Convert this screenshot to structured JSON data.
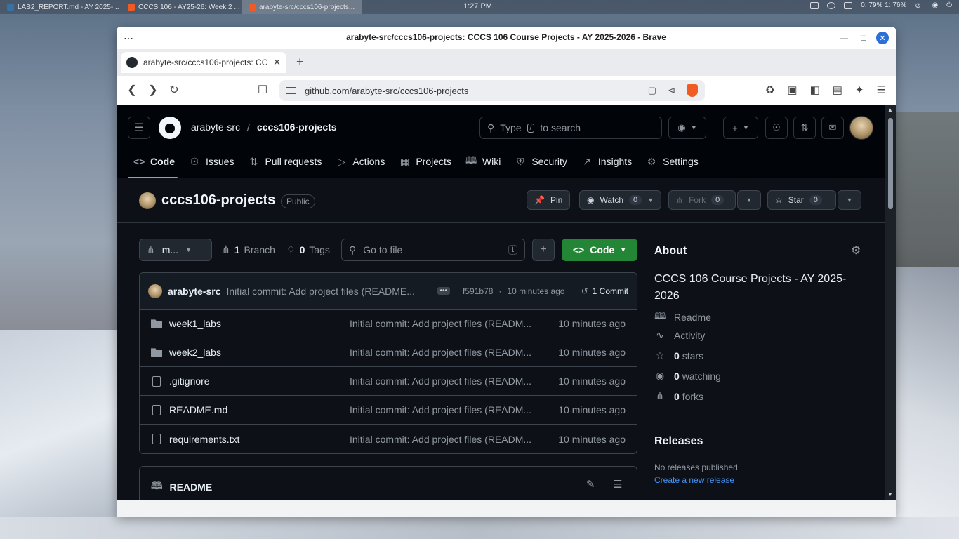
{
  "desktop": {
    "tasks": [
      {
        "label": "LAB2_REPORT.md - AY 2025-...",
        "color": "#3572a5"
      },
      {
        "label": "CCCS 106 - AY25-26: Week 2 ...",
        "color": "#f05b24"
      },
      {
        "label": "arabyte-src/cccs106-projects...",
        "color": "#f05b24"
      }
    ],
    "clock": "1:27 PM",
    "tray_text": "0: 79%  1: 76%"
  },
  "browser": {
    "window_title": "arabyte-src/cccs106-projects: CCCS 106 Course Projects - AY 2025-2026 - Brave",
    "tab_title": "arabyte-src/cccs106-projects: CCCS 106 Course Projects - AY 2025-2026",
    "url": "github.com/arabyte-src/cccs106-projects",
    "brave_color": "#f05b24"
  },
  "header": {
    "owner": "arabyte-src",
    "separator": "/",
    "repo": "cccs106-projects",
    "search_placeholder_pre": "Type",
    "search_key": "/",
    "search_placeholder_post": "to search"
  },
  "repo_nav": [
    {
      "label": "Code",
      "icon": "code-icon"
    },
    {
      "label": "Issues",
      "icon": "issue-icon"
    },
    {
      "label": "Pull requests",
      "icon": "pull-request-icon"
    },
    {
      "label": "Actions",
      "icon": "actions-icon"
    },
    {
      "label": "Projects",
      "icon": "table-icon"
    },
    {
      "label": "Wiki",
      "icon": "book-icon"
    },
    {
      "label": "Security",
      "icon": "shield-icon"
    },
    {
      "label": "Insights",
      "icon": "graph-icon"
    },
    {
      "label": "Settings",
      "icon": "gear-icon"
    }
  ],
  "repo": {
    "name": "cccs106-projects",
    "visibility": "Public",
    "pin_label": "Pin",
    "watch_label": "Watch",
    "watch_count": "0",
    "fork_label": "Fork",
    "fork_count": "0",
    "star_label": "Star",
    "star_count": "0"
  },
  "controls": {
    "branch": "m...",
    "branch_count": "1",
    "branch_label": "Branch",
    "tag_count": "0",
    "tag_label": "Tags",
    "gofile_placeholder": "Go to file",
    "gofile_key": "t",
    "code_label": "Code"
  },
  "commit": {
    "author": "arabyte-src",
    "message": "Initial commit: Add project files (README...",
    "sha": "f591b78",
    "time": "10 minutes ago",
    "count_label": "1 Commit"
  },
  "files": [
    {
      "type": "folder",
      "name": "week1_labs",
      "message": "Initial commit: Add project files (READM...",
      "time": "10 minutes ago"
    },
    {
      "type": "folder",
      "name": "week2_labs",
      "message": "Initial commit: Add project files (READM...",
      "time": "10 minutes ago"
    },
    {
      "type": "file",
      "name": ".gitignore",
      "message": "Initial commit: Add project files (READM...",
      "time": "10 minutes ago"
    },
    {
      "type": "file",
      "name": "README.md",
      "message": "Initial commit: Add project files (READM...",
      "time": "10 minutes ago"
    },
    {
      "type": "file",
      "name": "requirements.txt",
      "message": "Initial commit: Add project files (READM...",
      "time": "10 minutes ago"
    }
  ],
  "readme": {
    "title": "README"
  },
  "about": {
    "heading": "About",
    "description": "CCCS 106 Course Projects - AY 2025-2026",
    "readme_link": "Readme",
    "activity_link": "Activity",
    "stars_count": "0",
    "stars_label": "stars",
    "watching_count": "0",
    "watching_label": "watching",
    "forks_count": "0",
    "forks_label": "forks"
  },
  "releases": {
    "heading": "Releases",
    "none_text": "No releases published",
    "create_link": "Create a new release"
  },
  "colors": {
    "accent_green": "#238636",
    "link_blue": "#4493f8",
    "tab_underline": "#f78166",
    "page_bg": "#0d1117"
  }
}
